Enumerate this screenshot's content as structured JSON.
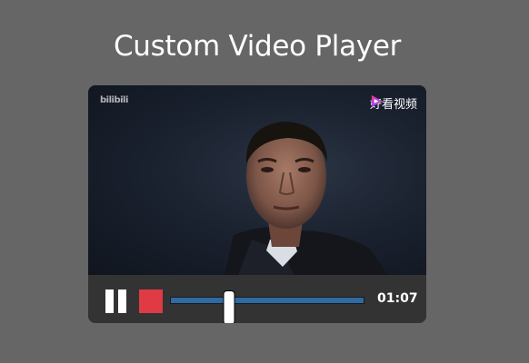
{
  "page": {
    "title": "Custom Video Player"
  },
  "video": {
    "watermark_left": "bilibili",
    "watermark_right": "好看视频",
    "watermark_right_icon": "play-triangle-logo"
  },
  "controls": {
    "pause_icon": "pause-icon",
    "stop_icon": "stop-icon",
    "progress_fraction": 0.3,
    "time": "01:07"
  },
  "colors": {
    "background": "#666666",
    "controls_bg": "#333333",
    "progress": "#2f6aa3",
    "stop": "#e03a45"
  }
}
